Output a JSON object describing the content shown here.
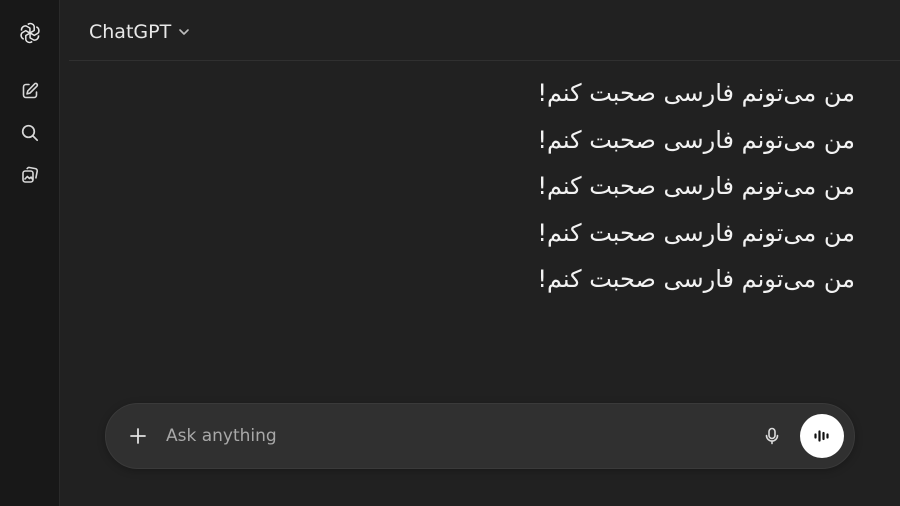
{
  "sidebar": {
    "logo_icon": "openai-logo-icon",
    "items": [
      {
        "id": "new-chat",
        "icon": "compose-icon"
      },
      {
        "id": "search",
        "icon": "search-icon"
      },
      {
        "id": "library",
        "icon": "images-icon"
      }
    ]
  },
  "header": {
    "model_name": "ChatGPT",
    "chevron_icon": "chevron-down-icon"
  },
  "messages": [
    "من می‌تونم فارسی صحبت کنم!",
    "من می‌تونم فارسی صحبت کنم!",
    "من می‌تونم فارسی صحبت کنم!",
    "من می‌تونم فارسی صحبت کنم!",
    "من می‌تونم فارسی صحبت کنم!"
  ],
  "composer": {
    "placeholder": "Ask anything",
    "value": "",
    "plus_icon": "plus-icon",
    "mic_icon": "microphone-icon",
    "voice_icon": "voice-mode-icon"
  },
  "colors": {
    "background": "#212121",
    "sidebar": "#181818",
    "composer": "#303030",
    "text": "#ececec",
    "voice_button": "#ffffff"
  }
}
